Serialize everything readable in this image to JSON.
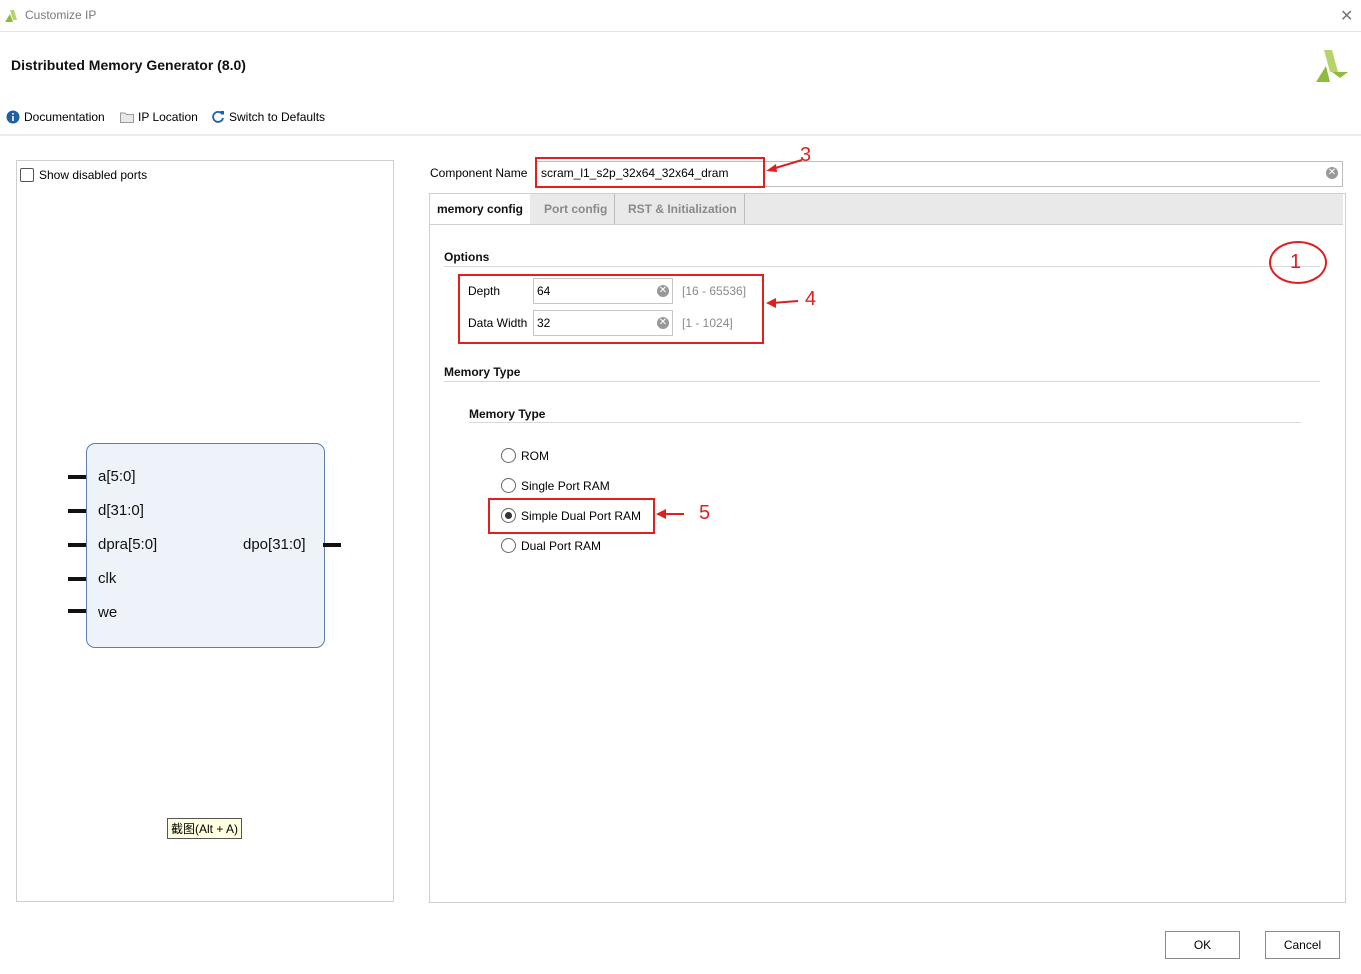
{
  "window": {
    "title": "Customize IP",
    "close_glyph": "✕"
  },
  "header": {
    "title": "Distributed Memory Generator (8.0)"
  },
  "toolbar": [
    {
      "label": "Documentation",
      "icon": "info-icon"
    },
    {
      "label": "IP Location",
      "icon": "folder-icon"
    },
    {
      "label": "Switch to Defaults",
      "icon": "refresh-icon"
    }
  ],
  "left_panel": {
    "show_disabled_ports": {
      "label": "Show disabled ports",
      "checked": false
    },
    "block": {
      "inputs": [
        "a[5:0]",
        "d[31:0]",
        "dpra[5:0]",
        "clk",
        "we"
      ],
      "outputs": [
        "dpo[31:0]"
      ]
    },
    "tooltip": "截图(Alt + A)"
  },
  "component": {
    "label": "Component Name",
    "value": "scram_l1_s2p_32x64_32x64_dram"
  },
  "tabs": [
    {
      "label": "memory config",
      "active": true
    },
    {
      "label": "Port config",
      "active": false
    },
    {
      "label": "RST & Initialization",
      "active": false
    }
  ],
  "options": {
    "title": "Options",
    "depth": {
      "label": "Depth",
      "value": "64",
      "range": "[16 - 65536]"
    },
    "width": {
      "label": "Data Width",
      "value": "32",
      "range": "[1 - 1024]"
    }
  },
  "memory_type": {
    "section_title": "Memory Type",
    "group_title": "Memory Type",
    "options": [
      {
        "label": "ROM",
        "selected": false
      },
      {
        "label": "Single Port RAM",
        "selected": false
      },
      {
        "label": "Simple Dual Port RAM",
        "selected": true
      },
      {
        "label": "Dual Port RAM",
        "selected": false
      }
    ]
  },
  "annotations": {
    "n1": "1",
    "n3": "3",
    "n4": "4",
    "n5": "5",
    "color": "#e02020"
  },
  "footer": {
    "ok": "OK",
    "cancel": "Cancel"
  },
  "colors": {
    "accent_green": "#8dbb3d",
    "info_blue": "#1f5fa8",
    "block_border": "#5b7fa6"
  }
}
